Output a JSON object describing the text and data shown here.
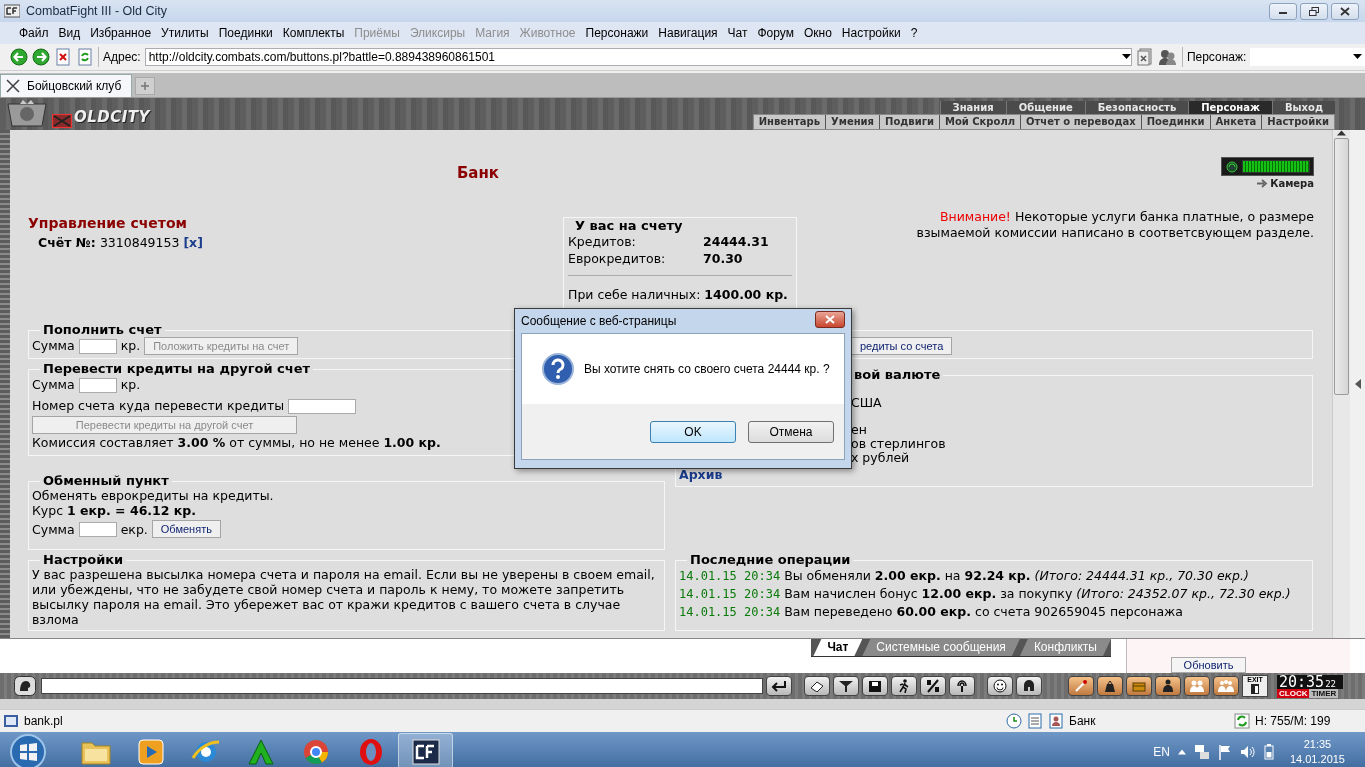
{
  "window": {
    "title": "CombatFight III - Old City"
  },
  "menu": [
    {
      "label": "Файл",
      "disabled": false
    },
    {
      "label": "Вид",
      "disabled": false
    },
    {
      "label": "Избранное",
      "disabled": false
    },
    {
      "label": "Утилиты",
      "disabled": false
    },
    {
      "label": "Поединки",
      "disabled": false
    },
    {
      "label": "Комплекты",
      "disabled": false
    },
    {
      "label": "Приёмы",
      "disabled": true
    },
    {
      "label": "Эликсиры",
      "disabled": true
    },
    {
      "label": "Магия",
      "disabled": true
    },
    {
      "label": "Животное",
      "disabled": true
    },
    {
      "label": "Персонажи",
      "disabled": false
    },
    {
      "label": "Навигация",
      "disabled": false
    },
    {
      "label": "Чат",
      "disabled": false
    },
    {
      "label": "Форум",
      "disabled": false
    },
    {
      "label": "Окно",
      "disabled": false
    },
    {
      "label": "Настройки",
      "disabled": false
    },
    {
      "label": "?",
      "disabled": false
    }
  ],
  "address": {
    "label": "Адрес:",
    "value": "http://oldcity.combats.com/buttons.pl?battle=0.889438960861501"
  },
  "character": {
    "label": "Персонаж:"
  },
  "tabs": [
    {
      "label": "Бойцовский клуб",
      "selected": true
    }
  ],
  "game_nav": {
    "logo": "OLDCITY",
    "top": [
      {
        "label": "Знания",
        "selected": false
      },
      {
        "label": "Общение",
        "selected": false
      },
      {
        "label": "Безопасность",
        "selected": false
      },
      {
        "label": "Персонаж",
        "selected": true
      },
      {
        "label": "Выход",
        "selected": false
      }
    ],
    "sub": [
      "Инвентарь",
      "Умения",
      "Подвиги",
      "Мой Скролл",
      "Отчет о переводах",
      "Поединки",
      "Анкета",
      "Настройки"
    ]
  },
  "camera": {
    "label": "Камера"
  },
  "bank": {
    "title": "Банк"
  },
  "account": {
    "heading": "Управление счетом",
    "number_label": "Счёт №:",
    "number": "3310849153",
    "close_link": "[x]"
  },
  "balance": {
    "legend": "У вас на счету",
    "rows": [
      {
        "label": "Кредитов:",
        "value": "24444.31"
      },
      {
        "label": "Еврокредитов:",
        "value": "70.30"
      }
    ],
    "cash_label": "При себе наличных:",
    "cash": "1400.00 кр."
  },
  "warning": {
    "prefix": "Внимание!",
    "text": "Некоторые услуги банка платные, о размере взымаемой комиссии написано в соответсвующем разделе."
  },
  "deposit": {
    "legend": "Пополнить счет",
    "sum_label": "Сумма",
    "unit": "кр.",
    "button": {
      "label": "Положить кредиты на счет",
      "disabled": true
    }
  },
  "withdraw": {
    "button": {
      "label": "редиты со счета",
      "disabled": false
    }
  },
  "transfer": {
    "legend": "Перевести кредиты на другой счет",
    "sum_label": "Сумма",
    "unit": "кр.",
    "account_label": "Номер счета куда перевести кредиты",
    "button": {
      "label": "Перевести кредиты на другой счет",
      "disabled": true
    },
    "commission": "Комиссия составляет **3.00 %** от суммы, но не менее **1.00 кр.**"
  },
  "currency": {
    "legend": "вой валюте",
    "lines": [
      "США",
      "ен",
      "ов стерлингов",
      "х рублей"
    ],
    "archive_link": "Архив"
  },
  "exchange": {
    "legend": "Обменный пункт",
    "description": "Обменять еврокредиты на кредиты.",
    "rate": "Курс **1 екр. = 46.12 кр.**",
    "sum_label": "Сумма",
    "unit": "екр.",
    "button": {
      "label": "Обменять",
      "disabled": false
    }
  },
  "settings": {
    "legend": "Настройки",
    "text": "У вас разрешена высылка номера счета и пароля на email. Если вы не уверены в своем email, или убеждены, что не забудете свой номер счета и пароль к нему, то можете запретить высылку пароля на email. Это убережет вас от кражи кредитов с вашего счета в случае взлома"
  },
  "operations": {
    "legend": "Последние операции",
    "rows": [
      {
        "time": "14.01.15 20:34",
        "text": "Вы обменяли **2.00 екр.** на **92.24 кр.** *(Итого: 24444.31 кр., 70.30 екр.)*"
      },
      {
        "time": "14.01.15 20:34",
        "text": "Вам начислен бонус **12.00 екр.** за покупку *(Итого: 24352.07 кр., 72.30 екр.)*"
      },
      {
        "time": "14.01.15 20:34",
        "text": "Вам переведено **60.00 екр.** со счета 902659045 персонажа"
      }
    ]
  },
  "dialog": {
    "title": "Сообщение с веб-страницы",
    "message": "Вы хотите снять со своего счета 24444 кр. ?",
    "buttons": [
      {
        "label": "OK",
        "selected": true
      },
      {
        "label": "Отмена",
        "selected": false
      }
    ]
  },
  "chat": {
    "tabs": [
      {
        "label": "Чат",
        "selected": true
      },
      {
        "label": "Системные сообщения",
        "selected": false
      },
      {
        "label": "Конфликты",
        "selected": false
      }
    ],
    "refresh_button": "Обновить"
  },
  "toolbar": {
    "exit_label": "EXIT",
    "time": "20:35",
    "seconds": "22",
    "clock_label": "CLOCK",
    "timer_label": "TIMER"
  },
  "status_bar": {
    "page": "bank.pl",
    "zone": "Банк",
    "stats": "H: 755/M: 199"
  },
  "taskbar": {
    "language": "EN",
    "time": "21:35",
    "date": "14.01.2015"
  }
}
